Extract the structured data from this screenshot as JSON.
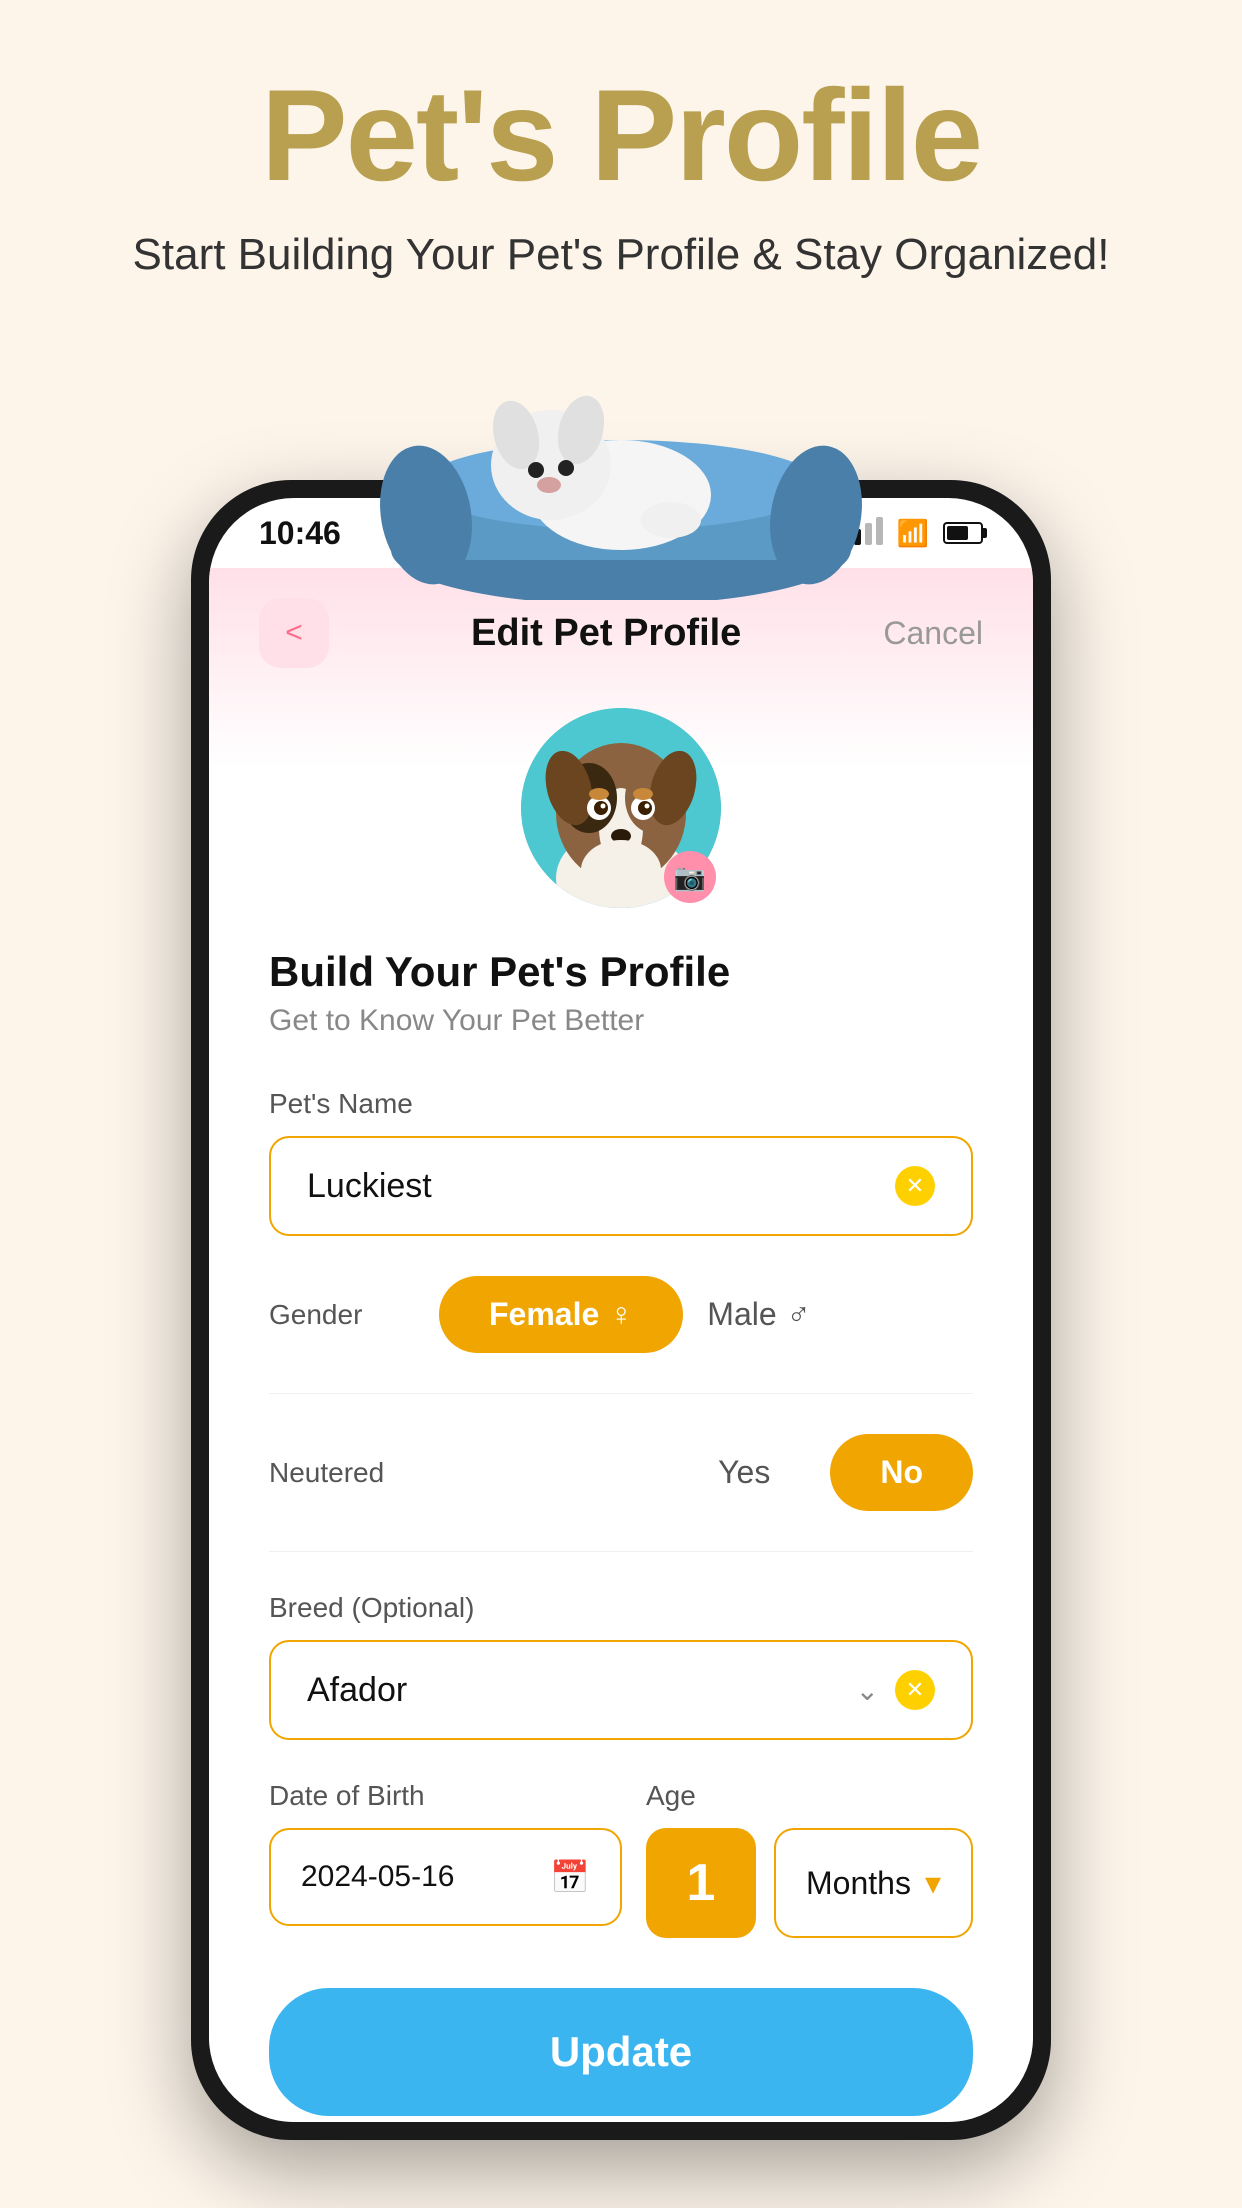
{
  "page": {
    "title": "Pet's Profile",
    "subtitle": "Start Building Your Pet's Profile & Stay Organized!",
    "background_color": "#fdf5ea",
    "title_color": "#b8a050"
  },
  "status_bar": {
    "time": "10:46",
    "signal": "2 bars",
    "wifi": "on",
    "battery": "67%"
  },
  "nav": {
    "back_label": "<",
    "title": "Edit Pet Profile",
    "cancel_label": "Cancel"
  },
  "form": {
    "section_title": "Build Your Pet's Profile",
    "section_subtitle": "Get to Know Your Pet Better",
    "pet_name_label": "Pet's Name",
    "pet_name_value": "Luckiest",
    "gender_label": "Gender",
    "gender_options": [
      "Female",
      "Male"
    ],
    "gender_selected": "Female",
    "female_symbol": "♀",
    "male_symbol": "♂",
    "neutered_label": "Neutered",
    "neutered_options": [
      "Yes",
      "No"
    ],
    "neutered_selected": "No",
    "breed_label": "Breed (Optional)",
    "breed_value": "Afador",
    "dob_label": "Date of Birth",
    "dob_value": "2024-05-16",
    "age_label": "Age",
    "age_value": "1",
    "age_unit": "Months",
    "update_label": "Update"
  }
}
